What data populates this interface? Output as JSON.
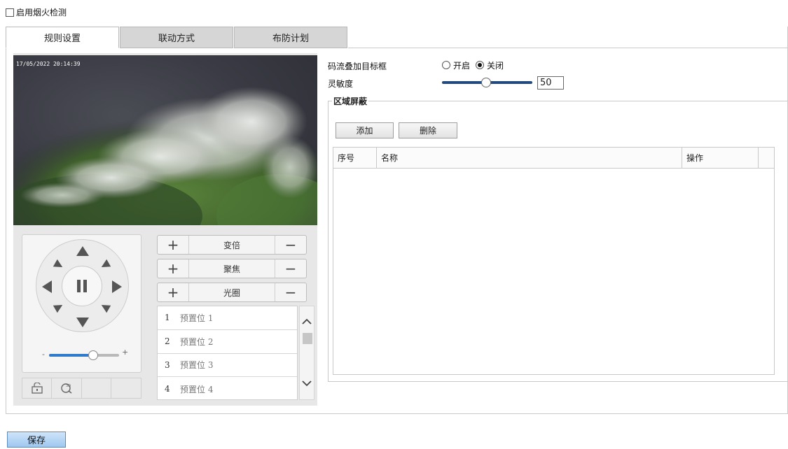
{
  "enable_label": "启用烟火检测",
  "tabs": [
    {
      "label": "规则设置",
      "active": true
    },
    {
      "label": "联动方式",
      "active": false
    },
    {
      "label": "布防计划",
      "active": false
    }
  ],
  "video": {
    "timestamp": "17/05/2022 20:14:39"
  },
  "ptz": {
    "zoom_label": "变倍",
    "focus_label": "聚焦",
    "iris_label": "光圈",
    "speed_value": 0.63,
    "speed_minus": "-",
    "speed_plus": "+",
    "tools": [
      "lock-icon",
      "3d-zoom-icon",
      "",
      ""
    ]
  },
  "presets": [
    {
      "num": "1",
      "name": "预置位 1"
    },
    {
      "num": "2",
      "name": "预置位 2"
    },
    {
      "num": "3",
      "name": "预置位 3"
    },
    {
      "num": "4",
      "name": "预置位 4"
    }
  ],
  "overlay": {
    "label": "码流叠加目标框",
    "on_label": "开启",
    "off_label": "关闭",
    "selected": "off"
  },
  "sensitivity": {
    "label": "灵敏度",
    "value": "50"
  },
  "mask": {
    "title": "区域屏蔽",
    "add_label": "添加",
    "delete_label": "删除",
    "columns": [
      "序号",
      "名称",
      "操作"
    ]
  },
  "save_label": "保存",
  "colors": {
    "accent": "#2f7bc9",
    "save_bg": "#b7d6f5"
  }
}
